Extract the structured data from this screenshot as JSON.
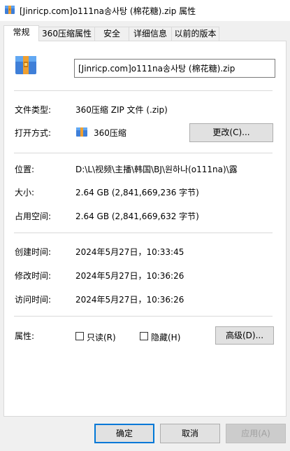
{
  "window": {
    "title": "[Jinricp.com]o111na송사탕 (棉花糖).zip 属性"
  },
  "tabs": [
    {
      "label": "常规"
    },
    {
      "label": "360压缩属性"
    },
    {
      "label": "安全"
    },
    {
      "label": "详细信息"
    },
    {
      "label": "以前的版本"
    }
  ],
  "file": {
    "name": "[Jinricp.com]o111na송사탕 (棉花糖).zip"
  },
  "type": {
    "label": "文件类型:",
    "value": "360压缩 ZIP 文件 (.zip)"
  },
  "opens_with": {
    "label": "打开方式:",
    "value": "360压缩",
    "change_button": "更改(C)..."
  },
  "location": {
    "label": "位置:",
    "value": "D:\\L\\视频\\主播\\韩国\\BJ\\원하나(o111na)\\露"
  },
  "size": {
    "label": "大小:",
    "value": "2.64 GB (2,841,669,236 字节)"
  },
  "size_on_disk": {
    "label": "占用空间:",
    "value": "2.64 GB (2,841,669,632 字节)"
  },
  "created": {
    "label": "创建时间:",
    "value": "2024年5月27日，10:33:45"
  },
  "modified": {
    "label": "修改时间:",
    "value": "2024年5月27日，10:36:26"
  },
  "accessed": {
    "label": "访问时间:",
    "value": "2024年5月27日，10:36:26"
  },
  "attributes": {
    "label": "属性:",
    "readonly_label": "只读(R)",
    "hidden_label": "隐藏(H)",
    "advanced_button": "高级(D)...",
    "readonly_checked": false,
    "hidden_checked": false
  },
  "footer": {
    "ok": "确定",
    "cancel": "取消",
    "apply": "应用(A)"
  },
  "icons": {
    "archive": "zip-archive-icon",
    "small_archive": "zip-archive-small-icon"
  },
  "colors": {
    "accent": "#0078d7",
    "archive_blue": "#3f7fd8",
    "archive_orange": "#f0a030"
  }
}
